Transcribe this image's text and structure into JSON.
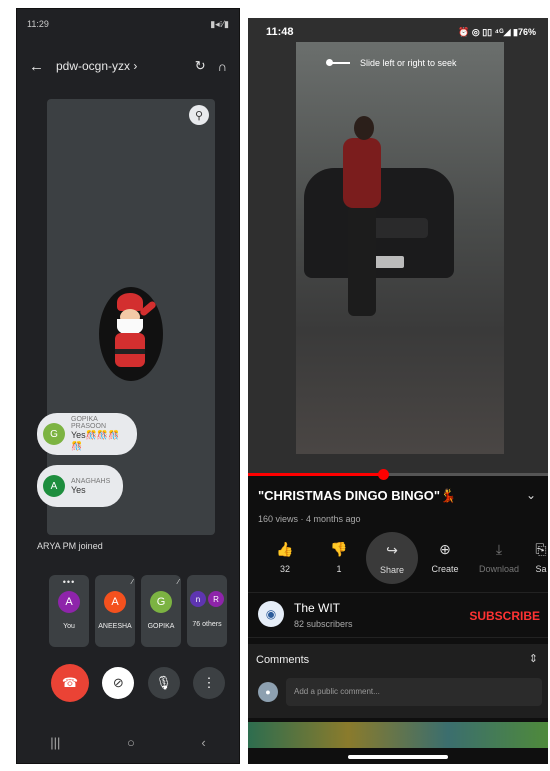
{
  "meet": {
    "status_bar": {
      "time": "11:29",
      "icons": "▮◂⁝⁄▮"
    },
    "meeting_code": "pdw-ocgn-yzx",
    "chat_messages": [
      {
        "initial": "G",
        "color": "#7cb342",
        "name": "GOPIKA PRASOON",
        "text": "Yes🎊🎊🎊🎊"
      },
      {
        "initial": "A",
        "color": "#1e8e3e",
        "name": "ANAGHAHS",
        "text": "Yes"
      }
    ],
    "joined_notice": "ARYA PM joined",
    "participants": [
      {
        "initial": "A",
        "color": "#8e24aa",
        "label": "You"
      },
      {
        "initial": "A",
        "color": "#f4511e",
        "label": "ANEESHA"
      },
      {
        "initial": "G",
        "color": "#7cb342",
        "label": "GOPIKA"
      },
      {
        "initials": [
          "n",
          "R"
        ],
        "colors": [
          "#5e35b1",
          "#8e24aa"
        ],
        "label": "76 others"
      }
    ],
    "nav": [
      "|||",
      "○",
      "‹"
    ]
  },
  "youtube": {
    "status_bar": {
      "time": "11:48",
      "icons": "⏰ ◎ ▯▯ ⁴ᴳ◢ ▮76%"
    },
    "seek_hint": "Slide left or right to seek",
    "progress": 0.45,
    "title": "\"CHRISTMAS DINGO BINGO\"💃",
    "meta": "160 views · 4 months ago",
    "actions": [
      {
        "icon": "👍",
        "label": "32"
      },
      {
        "icon": "👎",
        "label": "1"
      },
      {
        "icon": "↪",
        "label": "Share"
      },
      {
        "icon": "⊕",
        "label": "Create"
      },
      {
        "icon": "⤓",
        "label": "Download"
      },
      {
        "icon": "⎘",
        "label": "Sa"
      }
    ],
    "channel": {
      "name": "The WIT",
      "subs": "82 subscribers",
      "subscribe_label": "SUBSCRIBE"
    },
    "comments": {
      "label": "Comments",
      "placeholder": "Add a public comment..."
    }
  }
}
